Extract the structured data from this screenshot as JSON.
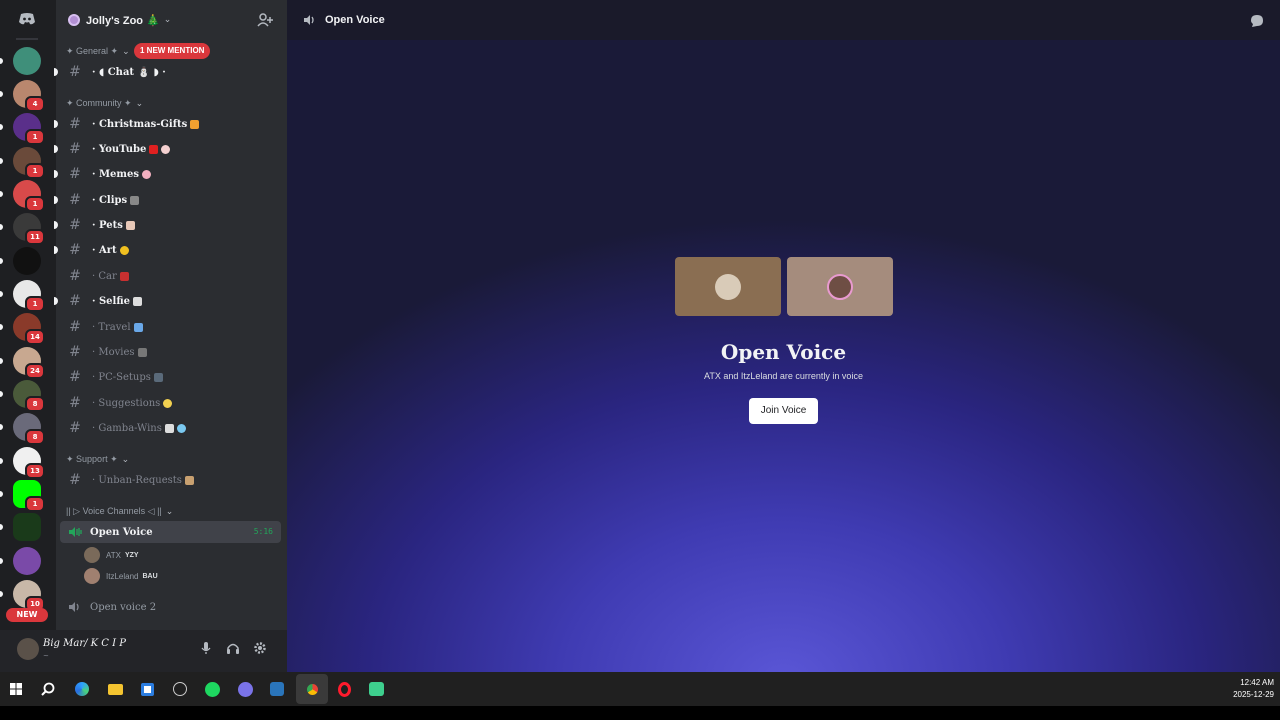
{
  "guild": {
    "name": "Jolly's Zoo 🎄",
    "new_mention": "1 NEW MENTION"
  },
  "rail": {
    "badges": [
      "",
      "4",
      "1",
      "1",
      "1",
      "11",
      "",
      "1",
      "14",
      "24",
      "8",
      "8",
      "13",
      "1",
      "",
      "",
      "10",
      ""
    ],
    "new_label": "NEW"
  },
  "categories": {
    "general": "✦ General ✦",
    "community": "✦ Community ✦",
    "support": "✦ Support ✦",
    "voice": "|| ▷ Voice Channels ◁ ||"
  },
  "channels": {
    "chat": "· ◖ Chat ⛄ ◗ ·",
    "christmas_gifts": "· Christmas-Gifts",
    "youtube": "· YouTube",
    "memes": "· Memes",
    "clips": "· Clips",
    "pets": "· Pets",
    "art": "· Art",
    "car": "· Car",
    "selfie": "· Selfie",
    "travel": "· Travel",
    "movies": "· Movies",
    "pc_setups": "· PC-Setups",
    "suggestions": "· Suggestions",
    "gamba_wins": "· Gamba-Wins",
    "unban_requests": "· Unban-Requests"
  },
  "voice": {
    "open_voice": "Open Voice",
    "time": "5:16",
    "users": [
      {
        "name": "ATX",
        "tag": "YZY"
      },
      {
        "name": "ItzLeland",
        "tag": "BAU"
      }
    ],
    "open_voice_2": "Open voice 2"
  },
  "user_panel": {
    "name": "Big Mar/ K C I P",
    "status": "~"
  },
  "main": {
    "header_title": "Open Voice",
    "title": "Open Voice",
    "subtitle": "ATX and ItzLeland are currently in voice",
    "join_label": "Join Voice"
  },
  "taskbar": {
    "time": "12:42 AM",
    "date": "2025-12-29"
  },
  "colors": {
    "accent_red": "#da373c",
    "sidebar": "#2b2d31",
    "rail": "#1e1f22",
    "voice_green": "#23a55a"
  }
}
